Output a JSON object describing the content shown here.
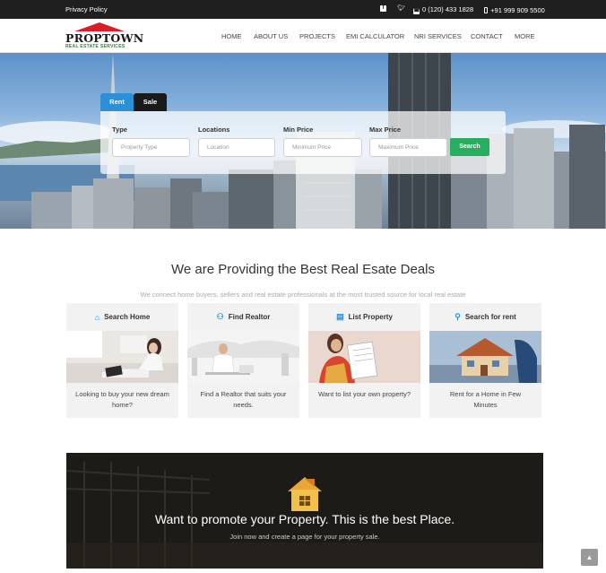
{
  "topbar": {
    "privacy": "Privacy Policy",
    "phone": "0 (120) 433 1828",
    "mobile": "+91 999 909 5500"
  },
  "logo": {
    "name": "PROPTOWN",
    "tagline": "REAL ESTATE SERVICES"
  },
  "nav": [
    "HOME",
    "ABOUT US",
    "PROJECTS",
    "EMI CALCULATOR",
    "NRI SERVICES",
    "CONTACT",
    "MORE"
  ],
  "search": {
    "tabs": [
      "Rent",
      "Sale"
    ],
    "fields": [
      {
        "label": "Type",
        "placeholder": "Property Type"
      },
      {
        "label": "Locations",
        "placeholder": "Location"
      },
      {
        "label": "Min Price",
        "placeholder": "Minimum Price"
      },
      {
        "label": "Max Price",
        "placeholder": "Maximum Price"
      }
    ],
    "button": "Search"
  },
  "section": {
    "title": "We are Providing the Best Real Esate Deals",
    "subtitle": "We connect home buyers, sellers and real estate professionals at the most trusted source for local real estate"
  },
  "cards": [
    {
      "title": "Search Home",
      "icon": "home-icon",
      "text": "Looking to buy your new dream home?"
    },
    {
      "title": "Find Realtor",
      "icon": "users-icon",
      "text": "Find a Realtor that suits your needs."
    },
    {
      "title": "List Property",
      "icon": "document-icon",
      "text": "Want to list your own property?"
    },
    {
      "title": "Search for rent",
      "icon": "key-icon",
      "text": "Rent for a Home in Few Minutes"
    }
  ],
  "promo": {
    "title": "Want to promote your Property. This is the best Place.",
    "subtitle": "Join now and create a page for your property sale."
  },
  "colors": {
    "accent": "#2d8fd6",
    "search_green": "#27ae60",
    "topbar": "#1f1f1f",
    "logo_red": "#d61f26"
  }
}
